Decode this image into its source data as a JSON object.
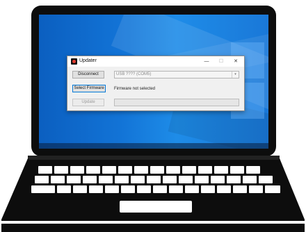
{
  "window": {
    "title": "Updater",
    "controls": {
      "minimize": "—",
      "maximize": "☐",
      "close": "✕"
    }
  },
  "buttons": {
    "disconnect": "Disconnect",
    "select_firmware": "Select Firmware",
    "update": "Update"
  },
  "port_select": {
    "value": "USB ???? (COM5)",
    "arrow": "▾"
  },
  "status": {
    "firmware": "Firmware not selected"
  },
  "progress": {
    "percent": 0
  },
  "colors": {
    "desktop": "#1273d6",
    "laptop_body": "#0d0d0d",
    "accent_border": "#0078d7",
    "app_icon": "#e23b2e"
  },
  "icons": {
    "app": "updater-app-icon"
  }
}
